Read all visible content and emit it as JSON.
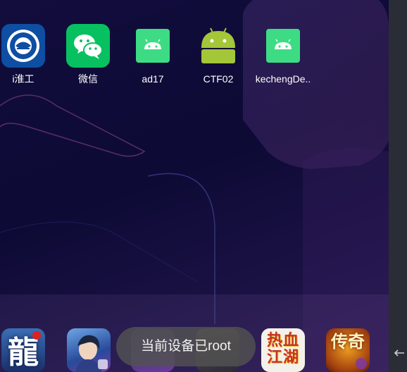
{
  "apps": [
    {
      "label": "i淮工",
      "icon": "ihuaigong-icon"
    },
    {
      "label": "微信",
      "icon": "wechat-icon"
    },
    {
      "label": "ad17",
      "icon": "android-icon"
    },
    {
      "label": "CTF02",
      "icon": "android-icon"
    },
    {
      "label": "kechengDe..",
      "icon": "android-icon"
    }
  ],
  "dock": {
    "apps": [
      {
        "icon": "game-long-icon"
      },
      {
        "icon": "game-warrior-icon"
      },
      {
        "icon": "game-hidden-icon"
      },
      {
        "icon": "game-hidden-icon"
      },
      {
        "icon": "game-rexuejianghu-icon"
      },
      {
        "icon": "game-chuanqi-icon"
      }
    ],
    "long_glyph": "龍",
    "rexue_glyph": "热血江湖",
    "chuanqi_glyph": "传奇"
  },
  "toast": {
    "text": "当前设备已root"
  },
  "colors": {
    "wechat": "#07c160",
    "android_tile": "#3ddc84",
    "android_robot": "#a4c639",
    "toast_bg": "#525252"
  }
}
